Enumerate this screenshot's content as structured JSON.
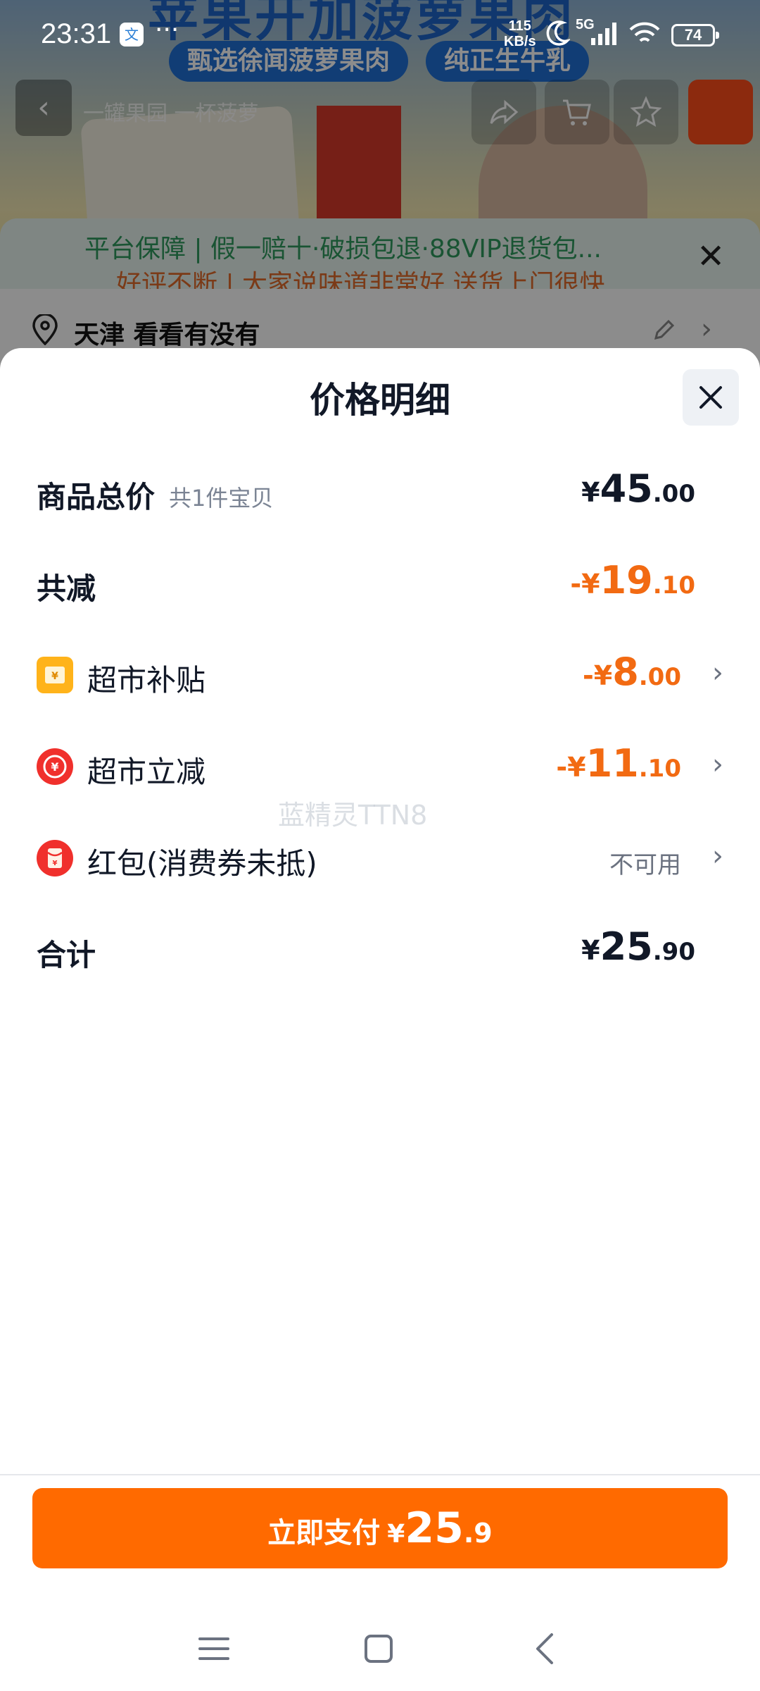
{
  "status_bar": {
    "time": "23:31",
    "more": "···",
    "speed_value": "115",
    "speed_unit": "KB/s",
    "network": "5G",
    "battery": "74"
  },
  "background_page": {
    "banner_title": "苹果开加菠萝果肉",
    "pill_1": "甄选徐闻菠萝果肉",
    "pill_2": "纯正生牛乳",
    "search_text": "一罐果园 一杯菠萝",
    "notice_line_1": "平台保障 | 假一赔十·破损包退·88VIP退货包...",
    "notice_line_2": "好评不断 | 大家说味道非常好 送货上门很快",
    "location": "天津  看看有没有"
  },
  "sheet": {
    "title": "价格明细",
    "rows": {
      "subtotal": {
        "label": "商品总价",
        "sub": "共1件宝贝",
        "currency": "¥",
        "int": "45",
        "dec": ".00"
      },
      "discount_total": {
        "label": "共减",
        "currency": "-¥",
        "int": "19",
        "dec": ".10"
      },
      "supermarket_subsidy": {
        "icon": "coupon-icon",
        "label": "超市补贴",
        "currency": "-¥",
        "int": "8",
        "dec": ".00"
      },
      "supermarket_instant": {
        "icon": "yuan-discount-icon",
        "label": "超市立减",
        "currency": "-¥",
        "int": "11",
        "dec": ".10"
      },
      "red_packet": {
        "icon": "red-packet-icon",
        "label": "红包(消费券未抵)",
        "status": "不可用"
      },
      "total": {
        "label": "合计",
        "currency": "¥",
        "int": "25",
        "dec": ".90"
      }
    },
    "watermark": "蓝精灵TTN8"
  },
  "pay_button": {
    "label": "立即支付",
    "currency": "¥",
    "int": "25",
    "dec": ".9"
  },
  "colors": {
    "accent_orange": "#ff6a00",
    "discount_orange": "#f26a12",
    "text_dark": "#111827",
    "text_muted": "#6b7280"
  }
}
